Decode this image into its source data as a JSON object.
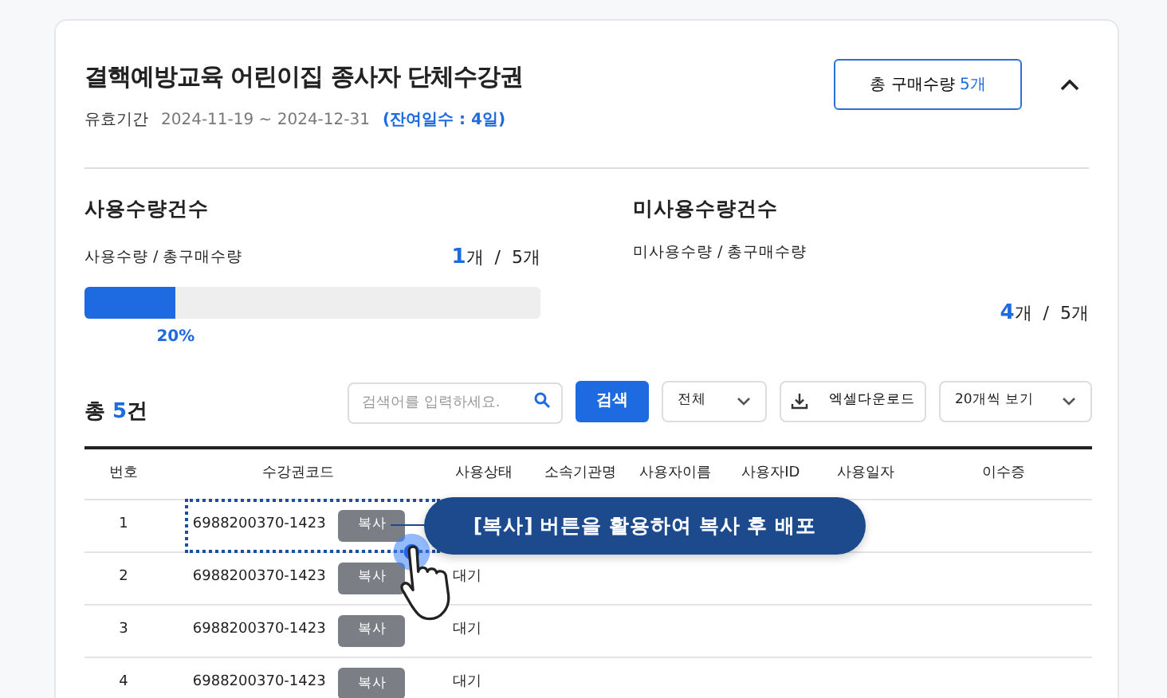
{
  "header": {
    "title": "결핵예방교육 어린이집 종사자 단체수강권",
    "validity_label": "유효기간",
    "period": "2024-11-19 ~ 2024-12-31",
    "remaining": "(잔여일수 : 4일)",
    "total_button": {
      "label": "총 구매수량",
      "count": "5개"
    },
    "expanded": true
  },
  "stats": [
    {
      "kind": "bar",
      "title": "사용수량건수",
      "caption": "사용수량 / 총구매수량",
      "count": "1",
      "unit": "개",
      "separator": "/",
      "total": "5개",
      "level": 0.2,
      "percent": "20%"
    },
    {
      "kind": "plain",
      "title": "미사용수량건수",
      "caption": "미사용수량 / 총구매수량",
      "count": "4",
      "unit": "개",
      "separator": "/",
      "total": "5개"
    }
  ],
  "summary": {
    "prefix": "총",
    "count": "5",
    "unit": "건"
  },
  "toolbar": {
    "search": {
      "placeholder": "검색어를 입력하세요."
    },
    "search_button": "검색",
    "filter": "전체",
    "excel_button": "엑셀다운로드",
    "page_size": "20개씩 보기"
  },
  "table": {
    "columns": [
      "번호",
      "수강권코드",
      "사용상태",
      "소속기관명",
      "사용자이름",
      "사용자ID",
      "사용일자",
      "이수증"
    ],
    "rows": [
      {
        "no": "1",
        "code": "6988200370-1423",
        "copy": "복사",
        "highlighted": true
      },
      {
        "no": "2",
        "code": "6988200370-1423",
        "copy": "복사",
        "status": "대기",
        "highlighted": false
      },
      {
        "no": "3",
        "code": "6988200370-1423",
        "copy": "복사",
        "status": "대기",
        "highlighted": false
      },
      {
        "no": "4",
        "code": "6988200370-1423",
        "copy": "복사",
        "status": "대기",
        "highlighted": false
      }
    ]
  },
  "callout": {
    "text": "[복사] 버튼을 활용하여 복사 후 배포"
  }
}
